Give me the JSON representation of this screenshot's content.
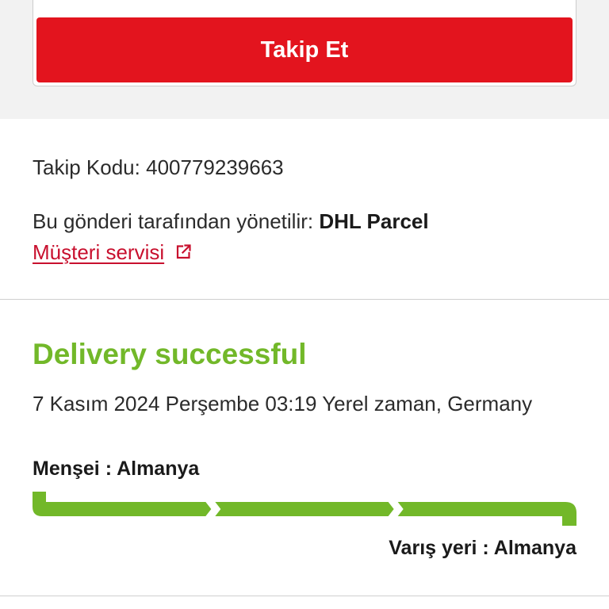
{
  "track_form": {
    "submit_label": "Takip Et"
  },
  "shipment_info": {
    "tracking_label": "Takip Kodu:",
    "tracking_number": "400779239663",
    "managed_by_label": "Bu gönderi tarafından yönetilir:",
    "carrier": "DHL Parcel",
    "customer_service": {
      "label": "Müşteri servisi",
      "icon": "external-link-icon"
    }
  },
  "status": {
    "title": "Delivery successful",
    "timestamp": "7 Kasım 2024 Perşembe 03:19 Yerel zaman, Germany",
    "origin": {
      "label": "Menşei :",
      "value": "Almanya"
    },
    "destination": {
      "label": "Varış yeri :",
      "value": "Almanya"
    },
    "progress": {
      "segments_total": 3,
      "segments_completed": 3
    }
  },
  "colors": {
    "brand_red": "#e3141e",
    "success_green": "#72b829",
    "link_red": "#c8102e",
    "pending_gray": "#cccccc",
    "text": "#2b2b2b"
  }
}
